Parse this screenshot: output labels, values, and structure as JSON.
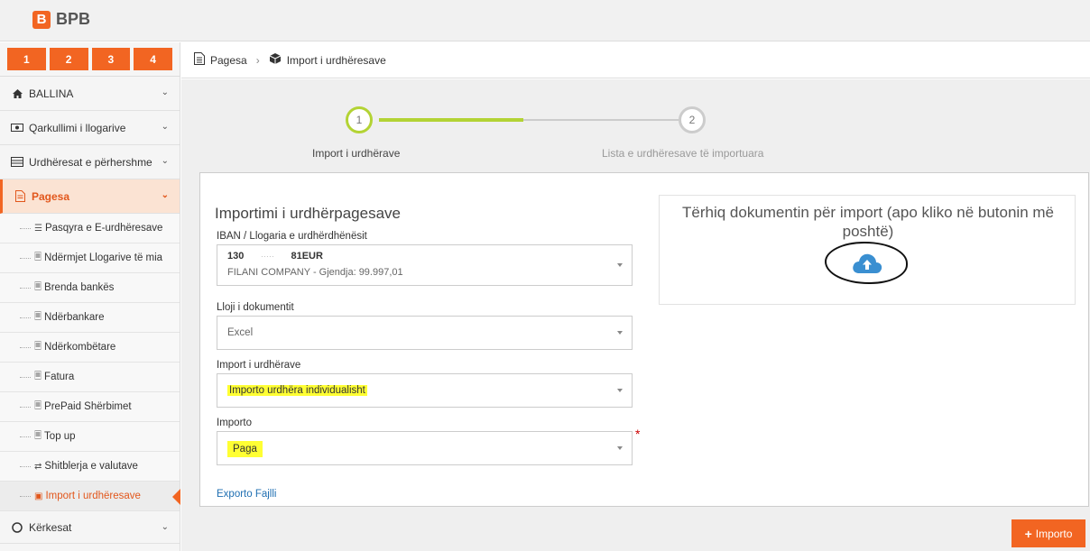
{
  "app": {
    "logo_mark": "B",
    "logo_text": "BPB"
  },
  "tabs_numbers": [
    "1",
    "2",
    "3",
    "4"
  ],
  "sidebar": {
    "ballina": "BALLINA",
    "qarkullimi": "Qarkullimi i llogarive",
    "urdheresat_perhershme": "Urdhëresat e përhershme",
    "pagesa": "Pagesa",
    "sub": [
      {
        "icon": "list-icon",
        "label": "Pasqyra e E-urdhëresave"
      },
      {
        "icon": "doc-icon",
        "label": "Ndërmjet Llogarive të mia"
      },
      {
        "icon": "doc-icon",
        "label": "Brenda bankës"
      },
      {
        "icon": "doc-icon",
        "label": "Ndërbankare"
      },
      {
        "icon": "doc-icon",
        "label": "Ndërkombëtare"
      },
      {
        "icon": "doc-icon",
        "label": "Fatura"
      },
      {
        "icon": "doc-icon",
        "label": "PrePaid Shërbimet"
      },
      {
        "icon": "doc-icon",
        "label": "Top up"
      },
      {
        "icon": "exchange-icon",
        "label": "Shitblerja e valutave"
      },
      {
        "icon": "box-icon",
        "label": "Import i urdhëresave"
      }
    ],
    "kerkesat": "Kërkesat"
  },
  "breadcrumb": {
    "parent": "Pagesa",
    "sep": "›",
    "current": "Import i urdhëresave"
  },
  "steps": [
    {
      "num": "1",
      "label": "Import i urdhërave"
    },
    {
      "num": "2",
      "label": "Lista e urdhëresave të importuara"
    }
  ],
  "form": {
    "title": "Importimi i urdhërpagesave",
    "iban_label": "IBAN / Llogaria e urdhërdhënësit",
    "iban_value_l1a": "130",
    "iban_value_l1b": "81EUR",
    "iban_value_l2": "FILANI COMPANY - Gjendja: 99.997,01",
    "doc_type_label": "Lloji i dokumentit",
    "doc_type_value": "Excel",
    "import_label": "Import i urdhërave",
    "import_value": "Importo urdhëra individualisht",
    "importo_label": "Importo",
    "importo_value": "Paga",
    "required_mark": "*",
    "export_link": "Exporto Fajlli"
  },
  "dropzone": {
    "text": "Tërhiq dokumentin për import (apo kliko në butonin më poshtë)",
    "icon": "cloud-upload-icon"
  },
  "actions": {
    "import_button": "Importo"
  },
  "colors": {
    "accent": "#f26522",
    "step_active": "#b3d334",
    "highlight": "#ffff33",
    "link": "#1f6fb2"
  }
}
